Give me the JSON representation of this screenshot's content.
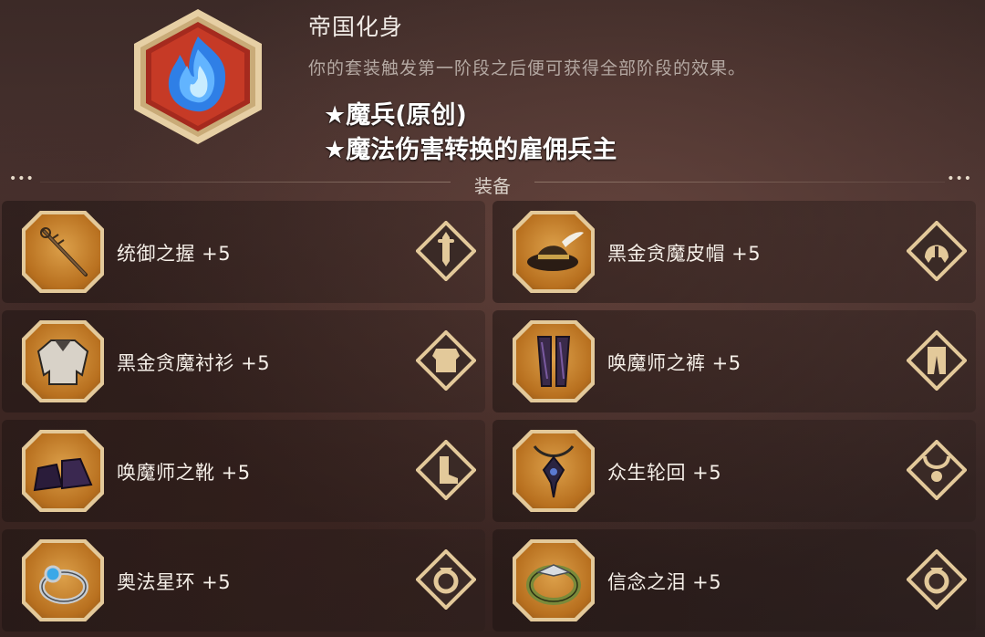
{
  "set": {
    "name": "帝国化身",
    "description": "你的套装触发第一阶段之后便可获得全部阶段的效果。",
    "bonuses": [
      "★魔兵(原创)",
      "★魔法伤害转换的雇佣兵主"
    ],
    "emblem_icon": "blue-flame-icon"
  },
  "section": {
    "title": "装备",
    "dots": "•••"
  },
  "equipment": [
    {
      "name": "统御之握 +5",
      "item_icon": "staff-icon",
      "slot_icon": "sword-slot-icon"
    },
    {
      "name": "黑金贪魔皮帽 +5",
      "item_icon": "feathered-hat-icon",
      "slot_icon": "helmet-slot-icon"
    },
    {
      "name": "黑金贪魔衬衫 +5",
      "item_icon": "shirt-icon",
      "slot_icon": "chest-armor-slot-icon"
    },
    {
      "name": "唤魔师之裤 +5",
      "item_icon": "pants-icon",
      "slot_icon": "pants-slot-icon"
    },
    {
      "name": "唤魔师之靴 +5",
      "item_icon": "boots-icon",
      "slot_icon": "boots-slot-icon"
    },
    {
      "name": "众生轮回 +5",
      "item_icon": "amulet-icon",
      "slot_icon": "necklace-slot-icon"
    },
    {
      "name": "奥法星环 +5",
      "item_icon": "blue-gem-ring-icon",
      "slot_icon": "ring-slot-icon"
    },
    {
      "name": "信念之泪 +5",
      "item_icon": "green-ring-icon",
      "slot_icon": "ring-slot-icon"
    }
  ],
  "colors": {
    "accent_gold": "#e3c99a",
    "slot_orange": "#c8832e",
    "bonus_text": "#ffffff",
    "desc_text": "#b4a8a2"
  }
}
